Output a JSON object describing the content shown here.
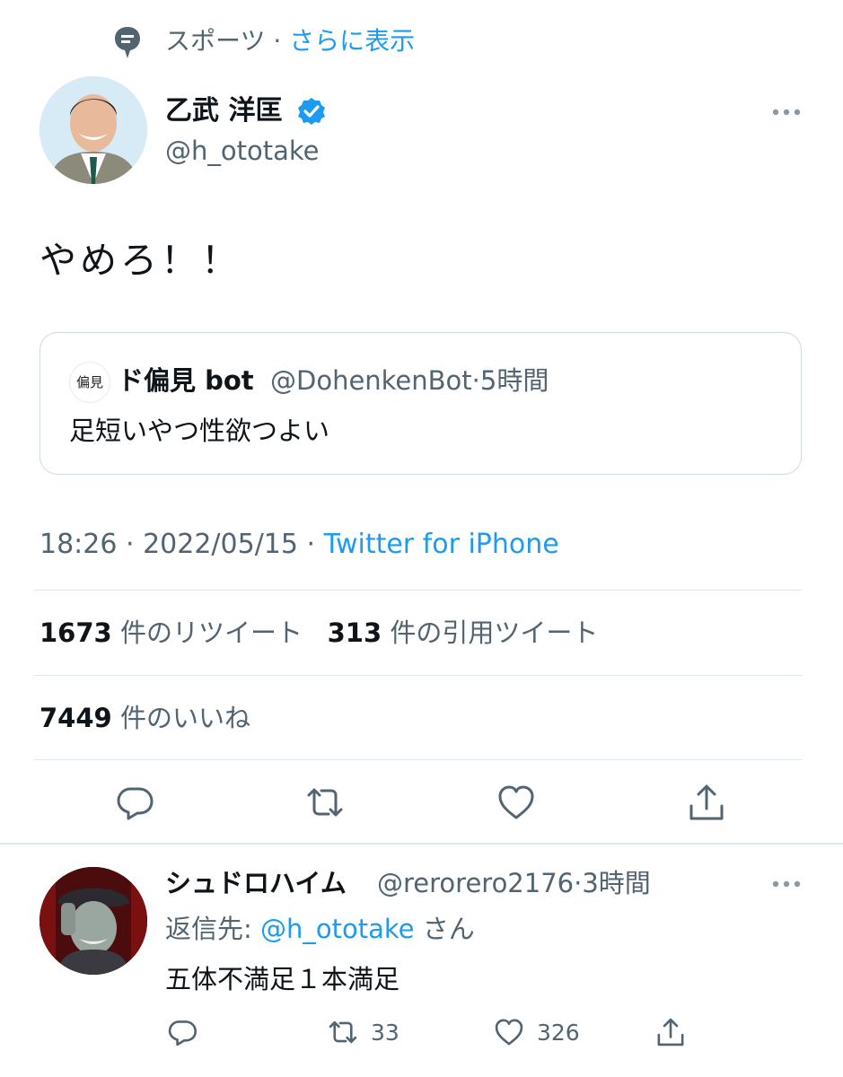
{
  "topic": {
    "label": "スポーツ",
    "separator": " · ",
    "show_more": "さらに表示"
  },
  "tweet": {
    "author_name": "乙武 洋匡",
    "author_handle": "@h_ototake",
    "text": "やめろ！！",
    "quote": {
      "avatar_text": "偏見",
      "name": "ド偏見 bot",
      "handle": "@DohenkenBot",
      "time": "5時間",
      "text": "足短いやつ性欲つよい"
    },
    "timestamp": "18:26 · 2022/05/15 · ",
    "source": "Twitter for iPhone",
    "retweets": {
      "count": "1673",
      "label": "件のリツイート"
    },
    "quotes": {
      "count": "313",
      "label": "件の引用ツイート"
    },
    "likes": {
      "count": "7449",
      "label": "件のいいね"
    }
  },
  "reply": {
    "author_name": "シュドロハイム",
    "handle": "@rerorero2176",
    "time": "3時間",
    "reply_to_prefix": "返信先: ",
    "reply_to_handle": "@h_ototake",
    "reply_to_suffix": "さん",
    "text": "五体不満足１本満足",
    "retweet_count": "33",
    "like_count": "326"
  },
  "icons": [
    "topic-icon",
    "verified-badge-icon",
    "more-icon",
    "reply-icon",
    "retweet-icon",
    "like-icon",
    "share-icon"
  ],
  "colors": {
    "accent": "#1d9bf0",
    "text": "#0f1419",
    "secondary": "#536471",
    "border": "#cfd9de"
  }
}
